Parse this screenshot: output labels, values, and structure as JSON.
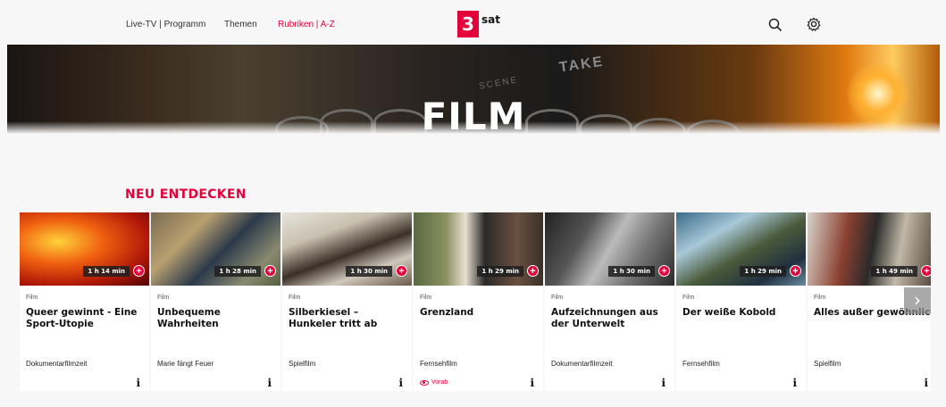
{
  "nav": {
    "links": [
      "Live-TV | Programm",
      "Themen",
      "Rubriken | A-Z"
    ],
    "logo_mark": "3",
    "logo_text": "sat"
  },
  "hero": {
    "title": "FILM",
    "clapper_take": "TAKE",
    "clapper_scene": "SCENE"
  },
  "section": {
    "title": "NEU ENTDECKEN"
  },
  "colors": {
    "accent": "#e4003a",
    "background": "#f7f7f7"
  },
  "cards": [
    {
      "duration": "1 h 14 min",
      "genre": "Film",
      "title": "Queer gewinnt - Eine Sport-Utopie",
      "series": "Dokumentarfilmzeit",
      "vorab": ""
    },
    {
      "duration": "1 h 28 min",
      "genre": "Film",
      "title": "Unbequeme Wahrheiten",
      "series": "Marie fängt Feuer",
      "vorab": ""
    },
    {
      "duration": "1 h 30 min",
      "genre": "Film",
      "title": "Silberkiesel – Hunkeler tritt ab",
      "series": "Spielfilm",
      "vorab": ""
    },
    {
      "duration": "1 h 29 min",
      "genre": "Film",
      "title": "Grenzland",
      "series": "Fernsehfilm",
      "vorab": "Vorab"
    },
    {
      "duration": "1 h 30 min",
      "genre": "Film",
      "title": "Aufzeichnungen aus der Unterwelt",
      "series": "Dokumentarfilmzeit",
      "vorab": ""
    },
    {
      "duration": "1 h 29 min",
      "genre": "Film",
      "title": "Der weiße Kobold",
      "series": "Fernsehfilm",
      "vorab": ""
    },
    {
      "duration": "1 h 49 min",
      "genre": "Film",
      "title": "Alles außer gewöhnlich",
      "series": "Spielfilm",
      "vorab": ""
    }
  ],
  "icons": {
    "search": "search-icon",
    "settings": "gear-icon",
    "add": "plus-circle-icon",
    "info": "info-icon",
    "next": "chevron-right-icon"
  }
}
